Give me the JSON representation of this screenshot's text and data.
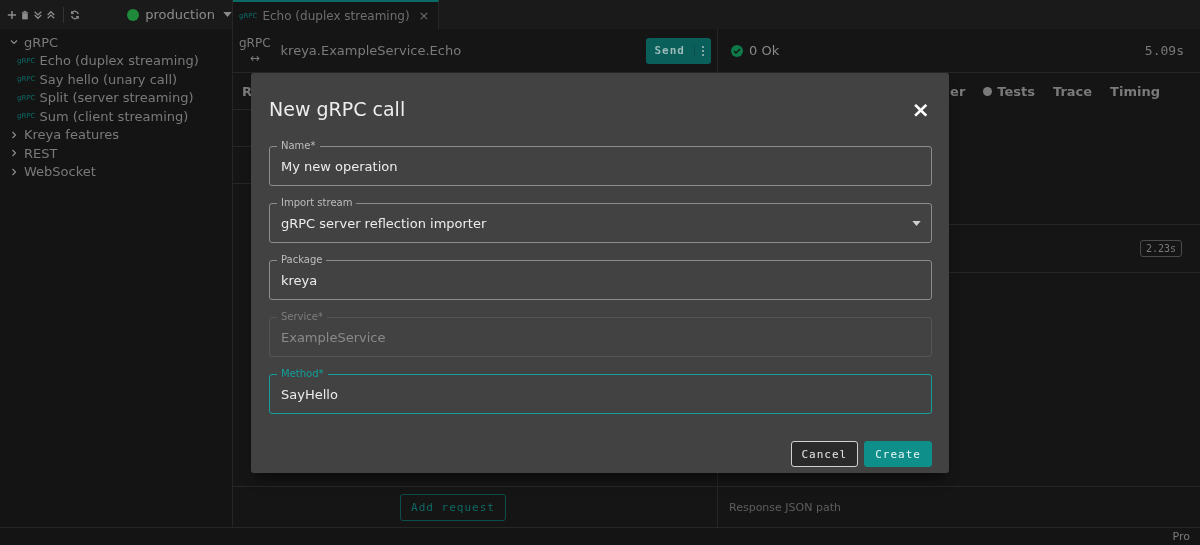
{
  "toolbar": {
    "environment": "production"
  },
  "sidebar": {
    "items": [
      {
        "label": "gRPC",
        "expanded": true,
        "children": [
          {
            "badge": "gRPC",
            "label": "Echo (duplex streaming)"
          },
          {
            "badge": "gRPC",
            "label": "Say hello (unary call)"
          },
          {
            "badge": "gRPC",
            "label": "Split (server streaming)"
          },
          {
            "badge": "gRPC",
            "label": "Sum (client streaming)"
          }
        ]
      },
      {
        "label": "Kreya features",
        "expanded": false
      },
      {
        "label": "REST",
        "expanded": false
      },
      {
        "label": "WebSocket",
        "expanded": false
      }
    ]
  },
  "tabs": [
    {
      "badge": "gRPC",
      "label": "Echo (duplex streaming)",
      "close": "×",
      "selected": true
    }
  ],
  "request": {
    "protocol": "gRPC",
    "arrow": "↔",
    "method": "kreya.ExampleService.Echo",
    "send": "Send",
    "tab_fragment": "R",
    "add_request": "Add request"
  },
  "response": {
    "status": "0 Ok",
    "duration": "5.09s",
    "tabs": [
      {
        "label": "er",
        "dot": false
      },
      {
        "label": "Tests",
        "dot": true
      },
      {
        "label": "Trace",
        "dot": false
      },
      {
        "label": "Timing",
        "dot": false
      }
    ],
    "timing_badge": "2.23s",
    "json_path": "Response JSON path"
  },
  "dialog": {
    "title": "New gRPC call",
    "close": "×",
    "fields": [
      {
        "kind": "text",
        "label": "Name*",
        "value": "My new operation",
        "disabled": false,
        "focused": false
      },
      {
        "kind": "select",
        "label": "Import stream",
        "value": "gRPC server reflection importer",
        "disabled": false,
        "focused": false
      },
      {
        "kind": "text",
        "label": "Package",
        "value": "kreya",
        "disabled": false,
        "focused": false
      },
      {
        "kind": "text",
        "label": "Service*",
        "value": "ExampleService",
        "disabled": true,
        "focused": false
      },
      {
        "kind": "text",
        "label": "Method*",
        "value": "SayHello",
        "disabled": false,
        "focused": true
      }
    ],
    "buttons": [
      {
        "kind": "secondary",
        "label": "Cancel"
      },
      {
        "kind": "primary",
        "label": "Create"
      }
    ]
  },
  "status_bar": {
    "plan": "Pro"
  }
}
